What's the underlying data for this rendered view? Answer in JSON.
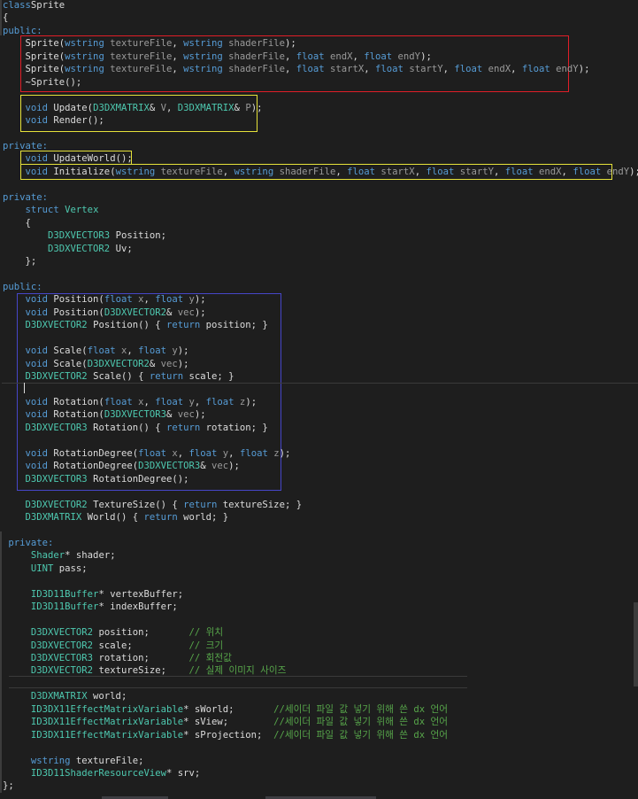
{
  "editor": {
    "lines": [
      {
        "segs": [
          [
            "kw",
            "class"
          ],
          [
            "",
            "Sprite"
          ]
        ]
      },
      {
        "segs": [
          [
            "",
            "{"
          ]
        ]
      },
      {
        "segs": [
          [
            "kw",
            "public:"
          ]
        ]
      },
      {
        "segs": [
          [
            "",
            "    "
          ],
          [
            "",
            "Sprite("
          ],
          [
            "kw",
            "wstring"
          ],
          [
            "pm",
            " textureFile"
          ],
          [
            "",
            ", "
          ],
          [
            "kw",
            "wstring"
          ],
          [
            "pm",
            " shaderFile"
          ],
          [
            "",
            ");"
          ]
        ]
      },
      {
        "segs": [
          [
            "",
            "    "
          ],
          [
            "",
            "Sprite("
          ],
          [
            "kw",
            "wstring"
          ],
          [
            "pm",
            " textureFile"
          ],
          [
            "",
            ", "
          ],
          [
            "kw",
            "wstring"
          ],
          [
            "pm",
            " shaderFile"
          ],
          [
            "",
            ", "
          ],
          [
            "kw",
            "float"
          ],
          [
            "pm",
            " endX"
          ],
          [
            "",
            ", "
          ],
          [
            "kw",
            "float"
          ],
          [
            "pm",
            " endY"
          ],
          [
            "",
            ");"
          ]
        ]
      },
      {
        "segs": [
          [
            "",
            "    "
          ],
          [
            "",
            "Sprite("
          ],
          [
            "kw",
            "wstring"
          ],
          [
            "pm",
            " textureFile"
          ],
          [
            "",
            ", "
          ],
          [
            "kw",
            "wstring"
          ],
          [
            "pm",
            " shaderFile"
          ],
          [
            "",
            ", "
          ],
          [
            "kw",
            "float"
          ],
          [
            "pm",
            " startX"
          ],
          [
            "",
            ", "
          ],
          [
            "kw",
            "float"
          ],
          [
            "pm",
            " startY"
          ],
          [
            "",
            ", "
          ],
          [
            "kw",
            "float"
          ],
          [
            "pm",
            " endX"
          ],
          [
            "",
            ", "
          ],
          [
            "kw",
            "float"
          ],
          [
            "pm",
            " endY"
          ],
          [
            "",
            ");"
          ]
        ]
      },
      {
        "segs": [
          [
            "",
            "    ~Sprite();"
          ]
        ]
      },
      {
        "segs": []
      },
      {
        "segs": [
          [
            "",
            "    "
          ],
          [
            "kw",
            "void"
          ],
          [
            "",
            " Update("
          ],
          [
            "ty",
            "D3DXMATRIX"
          ],
          [
            "",
            "& "
          ],
          [
            "pm",
            "V"
          ],
          [
            "",
            ", "
          ],
          [
            "ty",
            "D3DXMATRIX"
          ],
          [
            "",
            "& "
          ],
          [
            "pm",
            "P"
          ],
          [
            "",
            ");"
          ]
        ]
      },
      {
        "segs": [
          [
            "",
            "    "
          ],
          [
            "kw",
            "void"
          ],
          [
            "",
            " Render();"
          ]
        ]
      },
      {
        "segs": []
      },
      {
        "segs": [
          [
            "kw",
            "private:"
          ]
        ]
      },
      {
        "segs": [
          [
            "",
            "    "
          ],
          [
            "kw",
            "void"
          ],
          [
            "",
            " UpdateWorld();"
          ]
        ]
      },
      {
        "segs": [
          [
            "",
            "    "
          ],
          [
            "kw",
            "void"
          ],
          [
            "",
            " Initialize("
          ],
          [
            "kw",
            "wstring"
          ],
          [
            "pm",
            " textureFile"
          ],
          [
            "",
            ", "
          ],
          [
            "kw",
            "wstring"
          ],
          [
            "pm",
            " shaderFile"
          ],
          [
            "",
            ", "
          ],
          [
            "kw",
            "float"
          ],
          [
            "pm",
            " startX"
          ],
          [
            "",
            ", "
          ],
          [
            "kw",
            "float"
          ],
          [
            "pm",
            " startY"
          ],
          [
            "",
            ", "
          ],
          [
            "kw",
            "float"
          ],
          [
            "pm",
            " endX"
          ],
          [
            "",
            ", "
          ],
          [
            "kw",
            "float"
          ],
          [
            "pm",
            " endY"
          ],
          [
            "",
            ");"
          ]
        ]
      },
      {
        "segs": []
      },
      {
        "segs": [
          [
            "kw",
            "private:"
          ]
        ]
      },
      {
        "segs": [
          [
            "",
            "    "
          ],
          [
            "kw",
            "struct"
          ],
          [
            "ty",
            " Vertex"
          ]
        ]
      },
      {
        "segs": [
          [
            "",
            "    {"
          ]
        ]
      },
      {
        "segs": [
          [
            "",
            "        "
          ],
          [
            "ty",
            "D3DXVECTOR3"
          ],
          [
            "",
            " Position;"
          ]
        ]
      },
      {
        "segs": [
          [
            "",
            "        "
          ],
          [
            "ty",
            "D3DXVECTOR2"
          ],
          [
            "",
            " Uv;"
          ]
        ]
      },
      {
        "segs": [
          [
            "",
            "    };"
          ]
        ]
      },
      {
        "segs": []
      },
      {
        "segs": [
          [
            "kw",
            "public:"
          ]
        ]
      },
      {
        "segs": [
          [
            "",
            "    "
          ],
          [
            "kw",
            "void"
          ],
          [
            "",
            " Position("
          ],
          [
            "kw",
            "float"
          ],
          [
            "pm",
            " x"
          ],
          [
            "",
            ", "
          ],
          [
            "kw",
            "float"
          ],
          [
            "pm",
            " y"
          ],
          [
            "",
            ");"
          ]
        ]
      },
      {
        "segs": [
          [
            "",
            "    "
          ],
          [
            "kw",
            "void"
          ],
          [
            "",
            " Position("
          ],
          [
            "ty",
            "D3DXVECTOR2"
          ],
          [
            "",
            "& "
          ],
          [
            "pm",
            "vec"
          ],
          [
            "",
            ");"
          ]
        ]
      },
      {
        "segs": [
          [
            "",
            "    "
          ],
          [
            "ty",
            "D3DXVECTOR2"
          ],
          [
            "",
            " Position() { "
          ],
          [
            "kw",
            "return"
          ],
          [
            "",
            " position; }"
          ]
        ]
      },
      {
        "segs": []
      },
      {
        "segs": [
          [
            "",
            "    "
          ],
          [
            "kw",
            "void"
          ],
          [
            "",
            " Scale("
          ],
          [
            "kw",
            "float"
          ],
          [
            "pm",
            " x"
          ],
          [
            "",
            ", "
          ],
          [
            "kw",
            "float"
          ],
          [
            "pm",
            " y"
          ],
          [
            "",
            ");"
          ]
        ]
      },
      {
        "segs": [
          [
            "",
            "    "
          ],
          [
            "kw",
            "void"
          ],
          [
            "",
            " Scale("
          ],
          [
            "ty",
            "D3DXVECTOR2"
          ],
          [
            "",
            "& "
          ],
          [
            "pm",
            "vec"
          ],
          [
            "",
            ");"
          ]
        ]
      },
      {
        "segs": [
          [
            "",
            "    "
          ],
          [
            "ty",
            "D3DXVECTOR2"
          ],
          [
            "",
            " Scale() { "
          ],
          [
            "kw",
            "return"
          ],
          [
            "",
            " scale; }"
          ]
        ]
      },
      {
        "segs": []
      },
      {
        "segs": [
          [
            "",
            "    "
          ],
          [
            "kw",
            "void"
          ],
          [
            "",
            " Rotation("
          ],
          [
            "kw",
            "float"
          ],
          [
            "pm",
            " x"
          ],
          [
            "",
            ", "
          ],
          [
            "kw",
            "float"
          ],
          [
            "pm",
            " y"
          ],
          [
            "",
            ", "
          ],
          [
            "kw",
            "float"
          ],
          [
            "pm",
            " z"
          ],
          [
            "",
            ");"
          ]
        ]
      },
      {
        "segs": [
          [
            "",
            "    "
          ],
          [
            "kw",
            "void"
          ],
          [
            "",
            " Rotation("
          ],
          [
            "ty",
            "D3DXVECTOR3"
          ],
          [
            "",
            "& "
          ],
          [
            "pm",
            "vec"
          ],
          [
            "",
            ");"
          ]
        ]
      },
      {
        "segs": [
          [
            "",
            "    "
          ],
          [
            "ty",
            "D3DXVECTOR3"
          ],
          [
            "",
            " Rotation() { "
          ],
          [
            "kw",
            "return"
          ],
          [
            "",
            " rotation; }"
          ]
        ]
      },
      {
        "segs": []
      },
      {
        "segs": [
          [
            "",
            "    "
          ],
          [
            "kw",
            "void"
          ],
          [
            "",
            " RotationDegree("
          ],
          [
            "kw",
            "float"
          ],
          [
            "pm",
            " x"
          ],
          [
            "",
            ", "
          ],
          [
            "kw",
            "float"
          ],
          [
            "pm",
            " y"
          ],
          [
            "",
            ", "
          ],
          [
            "kw",
            "float"
          ],
          [
            "pm",
            " z"
          ],
          [
            "",
            ");"
          ]
        ]
      },
      {
        "segs": [
          [
            "",
            "    "
          ],
          [
            "kw",
            "void"
          ],
          [
            "",
            " RotationDegree("
          ],
          [
            "ty",
            "D3DXVECTOR3"
          ],
          [
            "",
            "& "
          ],
          [
            "pm",
            "vec"
          ],
          [
            "",
            ");"
          ]
        ]
      },
      {
        "segs": [
          [
            "",
            "    "
          ],
          [
            "ty",
            "D3DXVECTOR3"
          ],
          [
            "",
            " RotationDegree();"
          ]
        ]
      },
      {
        "segs": []
      },
      {
        "segs": [
          [
            "",
            "    "
          ],
          [
            "ty",
            "D3DXVECTOR2"
          ],
          [
            "",
            " TextureSize() { "
          ],
          [
            "kw",
            "return"
          ],
          [
            "",
            " textureSize; }"
          ]
        ]
      },
      {
        "segs": [
          [
            "",
            "    "
          ],
          [
            "ty",
            "D3DXMATRIX"
          ],
          [
            "",
            " World() { "
          ],
          [
            "kw",
            "return"
          ],
          [
            "",
            " world; }"
          ]
        ]
      },
      {
        "segs": []
      },
      {
        "segs": [
          [
            "",
            ""
          ],
          [
            "kw",
            " private:"
          ]
        ]
      },
      {
        "segs": [
          [
            "",
            "     "
          ],
          [
            "ty",
            "Shader"
          ],
          [
            "",
            "* shader;"
          ]
        ]
      },
      {
        "segs": [
          [
            "",
            "     "
          ],
          [
            "ty",
            "UINT"
          ],
          [
            "",
            " pass;"
          ]
        ]
      },
      {
        "segs": []
      },
      {
        "segs": [
          [
            "",
            "     "
          ],
          [
            "ty",
            "ID3D11Buffer"
          ],
          [
            "",
            "* vertexBuffer;"
          ]
        ]
      },
      {
        "segs": [
          [
            "",
            "     "
          ],
          [
            "ty",
            "ID3D11Buffer"
          ],
          [
            "",
            "* indexBuffer;"
          ]
        ]
      },
      {
        "segs": []
      },
      {
        "segs": [
          [
            "",
            "     "
          ],
          [
            "ty",
            "D3DXVECTOR2"
          ],
          [
            "",
            " position;       "
          ],
          [
            "cm",
            "// 위치"
          ]
        ]
      },
      {
        "segs": [
          [
            "",
            "     "
          ],
          [
            "ty",
            "D3DXVECTOR2"
          ],
          [
            "",
            " scale;          "
          ],
          [
            "cm",
            "// 크기"
          ]
        ]
      },
      {
        "segs": [
          [
            "",
            "     "
          ],
          [
            "ty",
            "D3DXVECTOR3"
          ],
          [
            "",
            " rotation;       "
          ],
          [
            "cm",
            "// 회전값"
          ]
        ]
      },
      {
        "segs": [
          [
            "",
            "     "
          ],
          [
            "ty",
            "D3DXVECTOR2"
          ],
          [
            "",
            " textureSize;    "
          ],
          [
            "cm",
            "// 실제 이미지 사이즈"
          ]
        ]
      },
      {
        "segs": []
      },
      {
        "segs": [
          [
            "",
            "     "
          ],
          [
            "ty",
            "D3DXMATRIX"
          ],
          [
            "",
            " world;"
          ]
        ]
      },
      {
        "segs": [
          [
            "",
            "     "
          ],
          [
            "ty",
            "ID3DX11EffectMatrixVariable"
          ],
          [
            "",
            "* sWorld;       "
          ],
          [
            "cm",
            "//세이더 파일 값 넣기 위해 쓴 dx 언어"
          ]
        ]
      },
      {
        "segs": [
          [
            "",
            "     "
          ],
          [
            "ty",
            "ID3DX11EffectMatrixVariable"
          ],
          [
            "",
            "* sView;        "
          ],
          [
            "cm",
            "//세이더 파일 값 넣기 위해 쓴 dx 언어"
          ]
        ]
      },
      {
        "segs": [
          [
            "",
            "     "
          ],
          [
            "ty",
            "ID3DX11EffectMatrixVariable"
          ],
          [
            "",
            "* sProjection;  "
          ],
          [
            "cm",
            "//세이더 파일 값 넣기 위해 쓴 dx 언어"
          ]
        ]
      },
      {
        "segs": []
      },
      {
        "segs": [
          [
            "",
            "     "
          ],
          [
            "kw",
            "wstring"
          ],
          [
            "",
            " textureFile;"
          ]
        ]
      },
      {
        "segs": [
          [
            "",
            "     "
          ],
          [
            "ty",
            "ID3D11ShaderResourceView"
          ],
          [
            "",
            "* srv;"
          ]
        ]
      },
      {
        "segs": [
          [
            "",
            "};"
          ]
        ]
      }
    ]
  }
}
